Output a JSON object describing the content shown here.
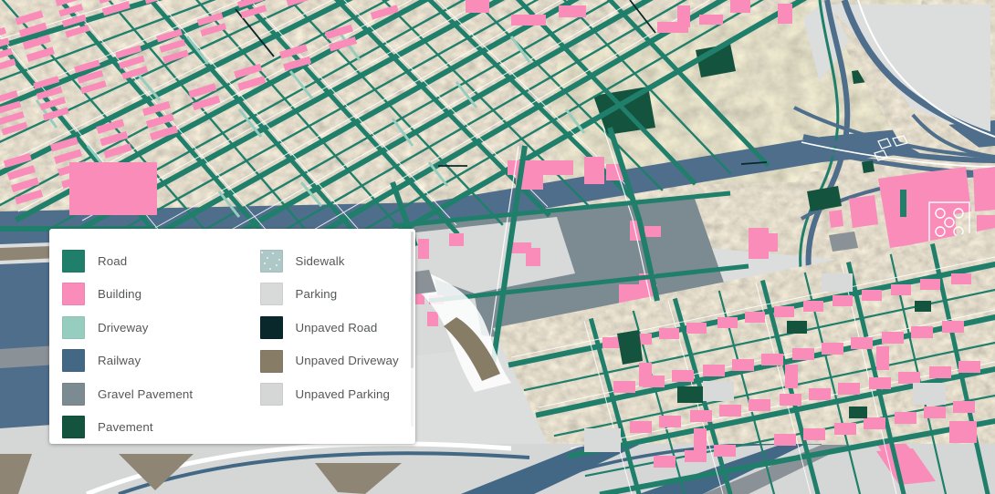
{
  "app": {
    "view": "satellite-map-with-segmentation-overlay"
  },
  "legend": {
    "title": "",
    "columns": [
      {
        "items": [
          {
            "label": "Road",
            "color": "#1f7f6b",
            "pattern": "solid"
          },
          {
            "label": "Building",
            "color": "#fa8cba",
            "pattern": "solid"
          },
          {
            "label": "Driveway",
            "color": "#97cdbe",
            "pattern": "solid"
          },
          {
            "label": "Railway",
            "color": "#436885",
            "pattern": "solid"
          },
          {
            "label": "Gravel Pavement",
            "color": "#7c8a91",
            "pattern": "solid"
          },
          {
            "label": "Pavement",
            "color": "#14543f",
            "pattern": "solid"
          }
        ]
      },
      {
        "items": [
          {
            "label": "Sidewalk",
            "color": "#aec8c8",
            "pattern": "speckle"
          },
          {
            "label": "Parking",
            "color": "#d8dad9",
            "pattern": "solid"
          },
          {
            "label": "Unpaved Road",
            "color": "#08282b",
            "pattern": "solid"
          },
          {
            "label": "Unpaved Driveway",
            "color": "#877c66",
            "pattern": "solid"
          },
          {
            "label": "Unpaved Parking",
            "color": "#d5d7d6",
            "pattern": "solid"
          }
        ]
      }
    ]
  },
  "map_palette": {
    "road": "#1f7f6b",
    "building": "#fa8cba",
    "driveway": "#97cdbe",
    "railway": "#436885",
    "gravel_pavement": "#7c8a91",
    "pavement": "#14543f",
    "sidewalk": "#aec8c8",
    "parking": "#d8dad9",
    "unpaved_road": "#08282b",
    "unpaved_driveway": "#877c66",
    "unpaved_parking": "#d5d7d6",
    "terrain_light": "#b5ab9b",
    "terrain_mid": "#8e8575",
    "terrain_dark": "#6d6658",
    "water": "#4e6e8c",
    "backdrop": "#dcdedd"
  }
}
